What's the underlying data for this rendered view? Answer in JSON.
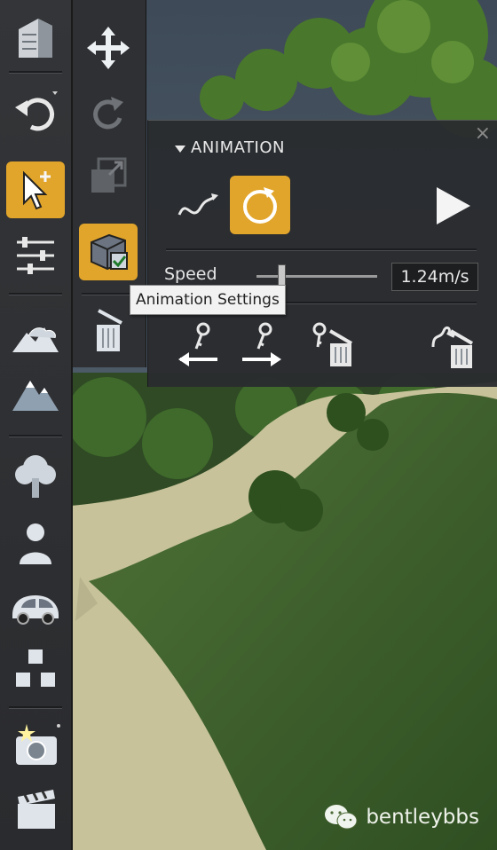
{
  "panel": {
    "title": "ANIMATION",
    "close_label": "×",
    "speed_label": "Speed",
    "speed_value": "1.24m/s"
  },
  "tooltip": "Animation Settings",
  "watermark": "bentleybbs",
  "colors": {
    "accent": "#e2a52b",
    "toolbar": "#2e3033",
    "panel": "#2a2c2f"
  },
  "icons": {
    "left_toolbar": [
      "building-icon",
      "undo-icon",
      "select-icon",
      "adjust-sliders-icon",
      "terrain-icon",
      "mountain-icon",
      "tree-icon",
      "person-icon",
      "car-icon",
      "objects-icon",
      "camera-icon",
      "clapperboard-icon"
    ],
    "sub_toolbar": [
      "move-icon",
      "rotate-icon",
      "scale-icon",
      "animation-settings-icon",
      "trash-icon"
    ],
    "panel": [
      "path-curve-icon",
      "loop-path-icon",
      "play-icon",
      "key-back-icon",
      "key-forward-icon",
      "delete-key-icon",
      "delete-path-icon"
    ]
  }
}
